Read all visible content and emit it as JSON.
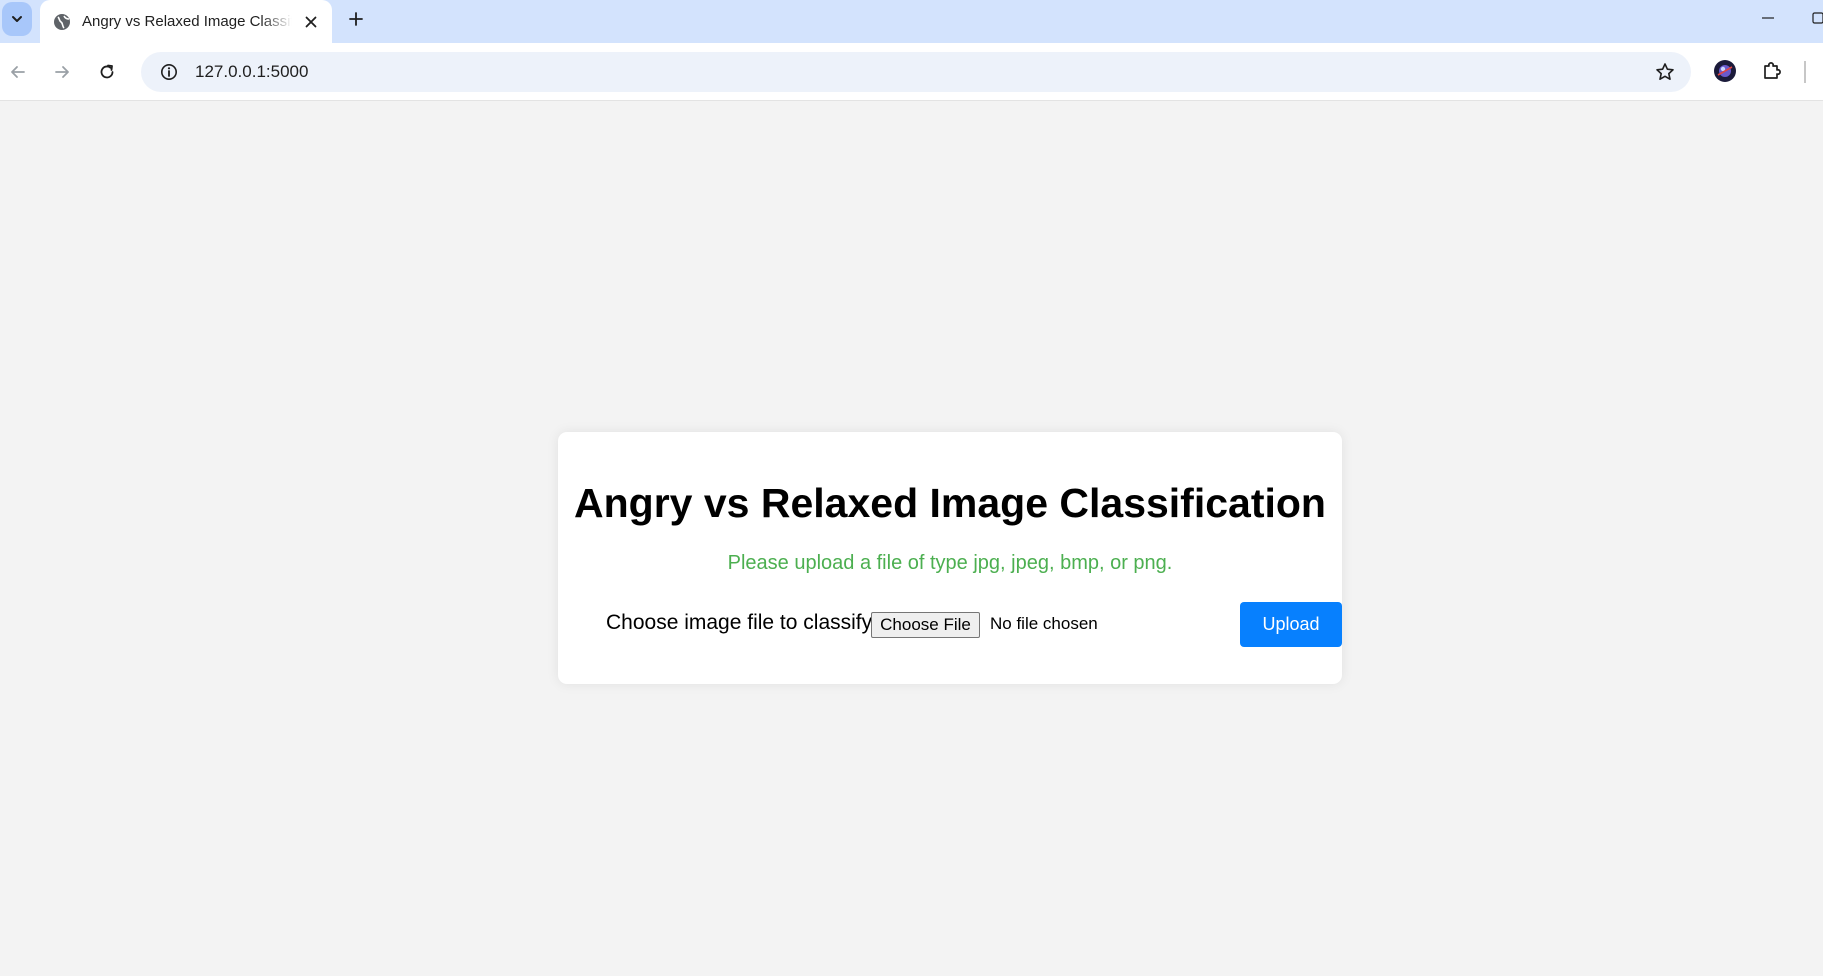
{
  "browser": {
    "tab_title": "Angry vs Relaxed Image Classification",
    "url": "127.0.0.1:5000"
  },
  "icons": {
    "tab_search": "chevron-down-icon",
    "favicon": "globe-icon",
    "close": "close-icon",
    "new_tab": "plus-icon",
    "back": "arrow-left-icon",
    "forward": "arrow-right-icon",
    "reload": "reload-icon",
    "site_info": "info-icon",
    "bookmark": "star-icon",
    "extensions": "puzzle-icon"
  },
  "page": {
    "title": "Angry vs Relaxed Image Classification",
    "hint": "Please upload a file of type jpg, jpeg, bmp, or png.",
    "form": {
      "label": "Choose image file to classify:",
      "file_button": "Choose File",
      "file_status": "No file chosen",
      "upload_button": "Upload"
    }
  },
  "colors": {
    "hint_green": "#4caf50",
    "upload_blue": "#0780fe",
    "tabstrip_blue": "#d3e3fd"
  }
}
